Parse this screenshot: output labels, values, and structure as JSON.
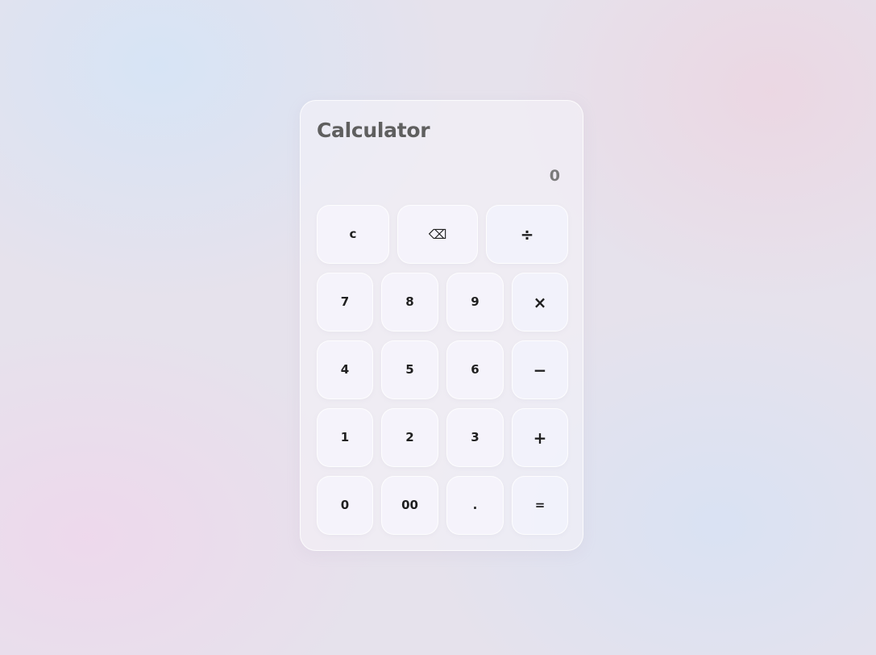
{
  "app": {
    "title": "Calculator",
    "display_value": "0"
  },
  "keypad": {
    "row1": [
      "c",
      "⌫",
      "÷"
    ],
    "row2": [
      "7",
      "8",
      "9",
      "×"
    ],
    "row3": [
      "4",
      "5",
      "6",
      "−"
    ],
    "row4": [
      "1",
      "2",
      "3",
      "+"
    ],
    "row5": [
      "0",
      "00",
      ".",
      "="
    ]
  },
  "colors": {
    "title": "#5f5f5f",
    "display": "#7a7a7a",
    "key_text": "#1f1f1f"
  }
}
